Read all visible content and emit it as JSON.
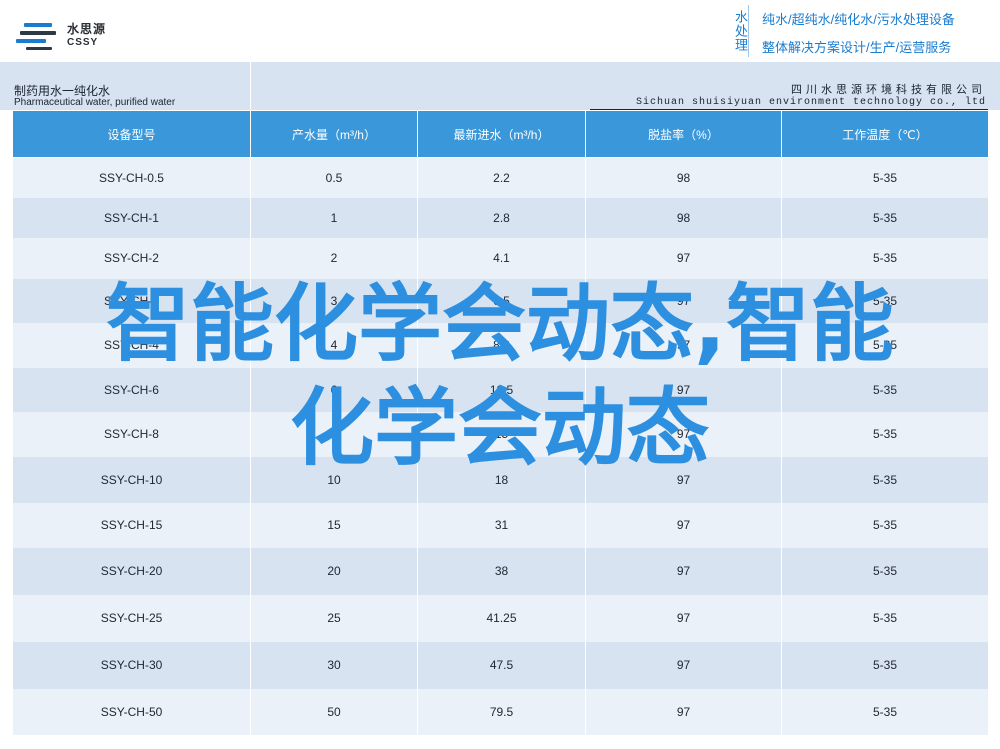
{
  "header": {
    "logo_cn": "水思源",
    "logo_en": "CSSY",
    "vertical_tag": "水处理",
    "slogan_line1": "纯水/超纯水/纯化水/污水处理设备",
    "slogan_line2": "整体解决方案设计/生产/运营服务"
  },
  "band": {
    "product_cn": "制药用水一纯化水",
    "product_en": "Pharmaceutical water, purified water",
    "company_cn": "四川水思源环境科技有限公司",
    "company_en": "Sichuan shuisiyuan environment technology co., ltd"
  },
  "table": {
    "headers": [
      "设备型号",
      "产水量（m³/h）",
      "最新进水（m³/h）",
      "脱盐率（%）",
      "工作温度（℃）"
    ],
    "rows": [
      [
        "SSY-CH-0.5",
        "0.5",
        "2.2",
        "98",
        "5-35"
      ],
      [
        "SSY-CH-1",
        "1",
        "2.8",
        "98",
        "5-35"
      ],
      [
        "SSY-CH-2",
        "2",
        "4.1",
        "97",
        "5-35"
      ],
      [
        "SSY-CH-3",
        "3",
        "6.5",
        "97",
        "5-35"
      ],
      [
        "SSY-CH-4",
        "4",
        "8.3",
        "97",
        "5-35"
      ],
      [
        "SSY-CH-6",
        "6",
        "12.5",
        "97",
        "5-35"
      ],
      [
        "SSY-CH-8",
        "8",
        "15",
        "97",
        "5-35"
      ],
      [
        "SSY-CH-10",
        "10",
        "18",
        "97",
        "5-35"
      ],
      [
        "SSY-CH-15",
        "15",
        "31",
        "97",
        "5-35"
      ],
      [
        "SSY-CH-20",
        "20",
        "38",
        "97",
        "5-35"
      ],
      [
        "SSY-CH-25",
        "25",
        "41.25",
        "97",
        "5-35"
      ],
      [
        "SSY-CH-30",
        "30",
        "47.5",
        "97",
        "5-35"
      ],
      [
        "SSY-CH-50",
        "50",
        "79.5",
        "97",
        "5-35"
      ]
    ]
  },
  "overlay": {
    "line1": "智能化学会动态,智能",
    "line2": "化学会动态"
  },
  "colors": {
    "header_blue": "#3a97d9",
    "row_dark": "#d7e3f0",
    "row_light": "#eaf1f8",
    "overlay_blue": "#2d8fe0",
    "slogan_blue": "#1a7ccf"
  }
}
